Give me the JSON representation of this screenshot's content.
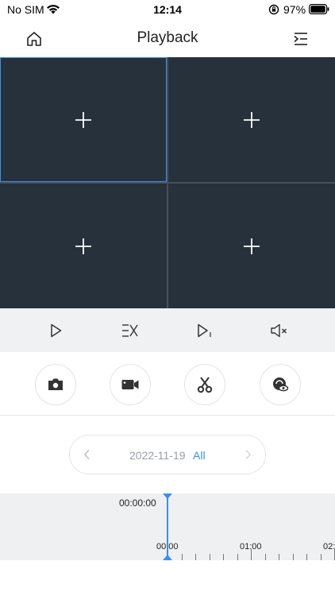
{
  "status_bar": {
    "carrier": "No SIM",
    "time": "12:14",
    "battery": "97%"
  },
  "nav": {
    "title": "Playback",
    "home_icon": "home-icon",
    "menu_icon": "menu-indent-icon"
  },
  "video_grid": {
    "cells": [
      {
        "icon": "plus-icon",
        "selected": true
      },
      {
        "icon": "plus-icon",
        "selected": false
      },
      {
        "icon": "plus-icon",
        "selected": false
      },
      {
        "icon": "plus-icon",
        "selected": false
      }
    ]
  },
  "controls": [
    {
      "icon": "play-icon"
    },
    {
      "icon": "speed-icon"
    },
    {
      "icon": "step-frame-icon"
    },
    {
      "icon": "mute-icon"
    }
  ],
  "actions": [
    {
      "icon": "camera-icon"
    },
    {
      "icon": "video-record-icon"
    },
    {
      "icon": "scissors-icon"
    },
    {
      "icon": "privacy-eye-icon"
    }
  ],
  "date_selector": {
    "date": "2022-11-19",
    "filter": "All"
  },
  "timeline": {
    "current_time": "00:00:00",
    "labels": [
      "00:00",
      "01:00",
      "02:"
    ]
  },
  "colors": {
    "accent": "#3d8fe8",
    "grid_bg": "#27313c"
  }
}
